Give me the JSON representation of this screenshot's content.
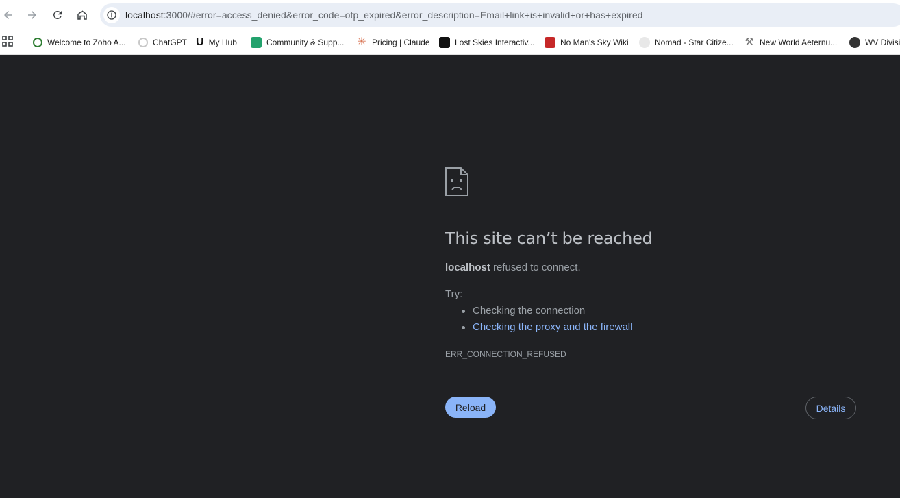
{
  "toolbar": {
    "back_icon": "back-arrow-icon",
    "forward_icon": "forward-arrow-icon",
    "reload_icon": "reload-icon",
    "home_icon": "home-icon",
    "site_info_icon": "info-icon",
    "url_host": "localhost",
    "url_rest": ":3000/#error=access_denied&error_code=otp_expired&error_description=Email+link+is+invalid+or+has+expired"
  },
  "bookmarks": [
    {
      "label": "Welcome to Zoho A...",
      "icon": "zoho-icon",
      "color": "#2e7d32"
    },
    {
      "label": "ChatGPT",
      "icon": "chatgpt-icon",
      "color": "#c8c8c8"
    },
    {
      "label": "My Hub",
      "icon": "hub-icon",
      "color": "#111111"
    },
    {
      "label": "Community & Supp...",
      "icon": "community-icon",
      "color": "#23a26d"
    },
    {
      "label": "Pricing | Claude",
      "icon": "claude-icon",
      "color": "#d97757"
    },
    {
      "label": "Lost Skies Interactiv...",
      "icon": "lost-skies-icon",
      "color": "#111111"
    },
    {
      "label": "No Man's Sky Wiki",
      "icon": "nms-wiki-icon",
      "color": "#c62828"
    },
    {
      "label": "Nomad - Star Citize...",
      "icon": "star-citizen-icon",
      "color": "#dddddd"
    },
    {
      "label": "New World Aeternu...",
      "icon": "new-world-icon",
      "color": "#777777"
    },
    {
      "label": "WV Divisi",
      "icon": "globe-icon",
      "color": "#333333"
    }
  ],
  "error": {
    "icon": "sad-page-icon",
    "title": "This site can’t be reached",
    "host": "localhost",
    "message": " refused to connect.",
    "try_label": "Try:",
    "suggestions": [
      "Checking the connection",
      "Checking the proxy and the firewall"
    ],
    "code": "ERR_CONNECTION_REFUSED",
    "reload_label": "Reload",
    "details_label": "Details"
  },
  "colors": {
    "background": "#202124",
    "accent": "#8ab4f8",
    "text": "#9aa0a6"
  }
}
